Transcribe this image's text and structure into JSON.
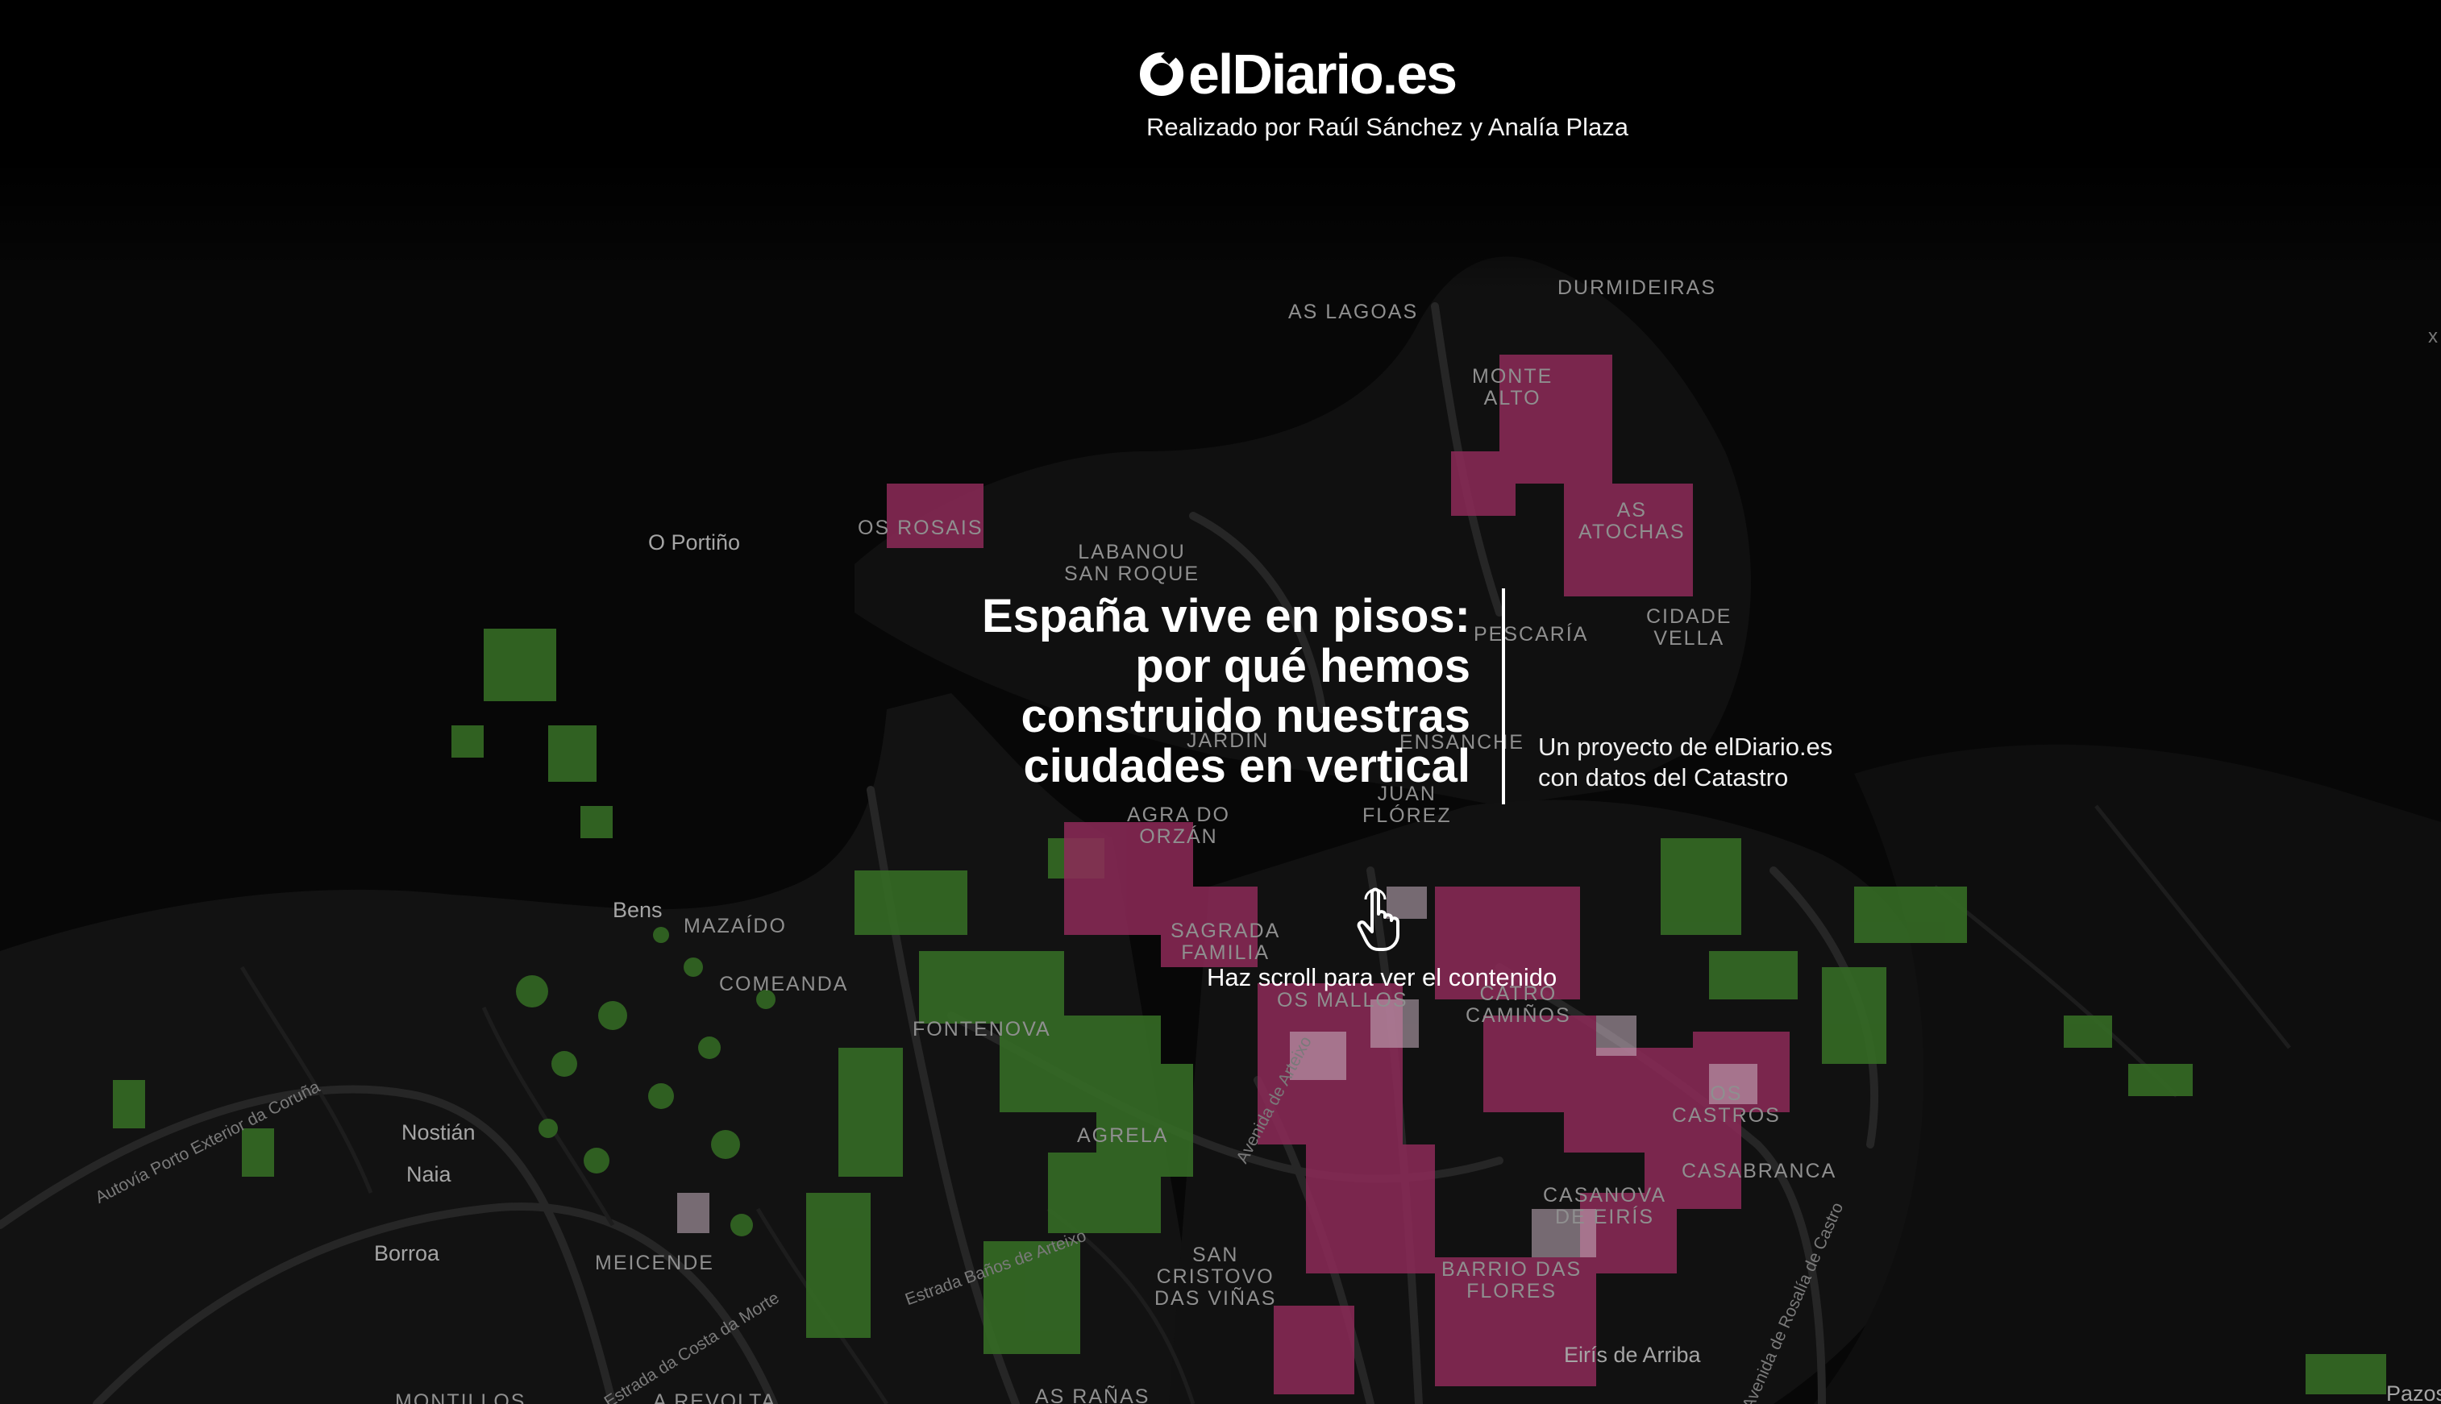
{
  "header": {
    "logo_text": "elDiario.es",
    "byline": "Realizado por Raúl Sánchez y Analía Plaza"
  },
  "hero": {
    "title_lines": [
      "España vive en pisos:",
      "por qué hemos",
      "construido nuestras",
      "ciudades en vertical"
    ],
    "subtitle_lines": [
      "Un proyecto de elDiario.es",
      "con datos del Catastro"
    ],
    "scroll_hint": "Haz scroll para ver el contenido"
  },
  "map": {
    "colors": {
      "background": "#070707",
      "roads": "#2a2a2a",
      "green_buildings": "#3f7d2c",
      "pink_buildings": "#b4376f",
      "light_buildings": "#d9c3cf"
    },
    "places": {
      "as_lagoas": "AS LAGOAS",
      "durmideiras": "DURMIDEIRAS",
      "monte_alto": "MONTE\nALTO",
      "as_atochas": "AS\nATOCHAS",
      "os_rosais": "OS ROSAIS",
      "o_portino": "O Portiño",
      "labanou": "LABANOU\nSAN ROQUE",
      "pescaria": "PESCARÍA",
      "cidade_vella": "CIDADE\nVELLA",
      "ensanche": "ENSANCHE",
      "jardin": "JARDÍN",
      "juan_florez": "JUAN\nFLÓREZ",
      "agra_orzan": "AGRA DO\nORZÁN",
      "bens": "Bens",
      "mazaido": "MAZAÍDO",
      "comeanda": "COMEANDA",
      "fontenova": "FONTENOVA",
      "sagrada_familia": "SAGRADA\nFAMILIA",
      "os_mallos": "OS MALLOS",
      "catro_caminos": "CATRO\nCAMIÑOS",
      "os_castros": "OS\nCASTROS",
      "casabranca": "CASABRANCA",
      "nostian": "Nostián",
      "naia": "Naia",
      "agrela": "AGRELA",
      "casanova_eiris": "CASANOVA\nDE EIRÍS",
      "borroa": "Borroa",
      "meicende": "MEICENDE",
      "san_cristovo": "SAN\nCRISTOVO\nDAS VIÑAS",
      "barrio_flores": "BARRIO DAS\nFLORES",
      "eiris_arriba": "Eirís de Arriba",
      "montillos": "MONTILLOS",
      "a_revolta": "A REVOLTA",
      "as_ranas": "AS RAÑAS",
      "pazos": "Pazos"
    },
    "roads": {
      "autovia": "Autovía Porto Exterior da Coruña",
      "estrada_banos": "Estrada Baños de Arteixo",
      "estrada_costa": "Estrada da Costa da Morte",
      "avenida": "Avenida de Arteixo",
      "rosalia": "Avenida de Rosalía de Castro"
    },
    "edge_mark": "x"
  }
}
